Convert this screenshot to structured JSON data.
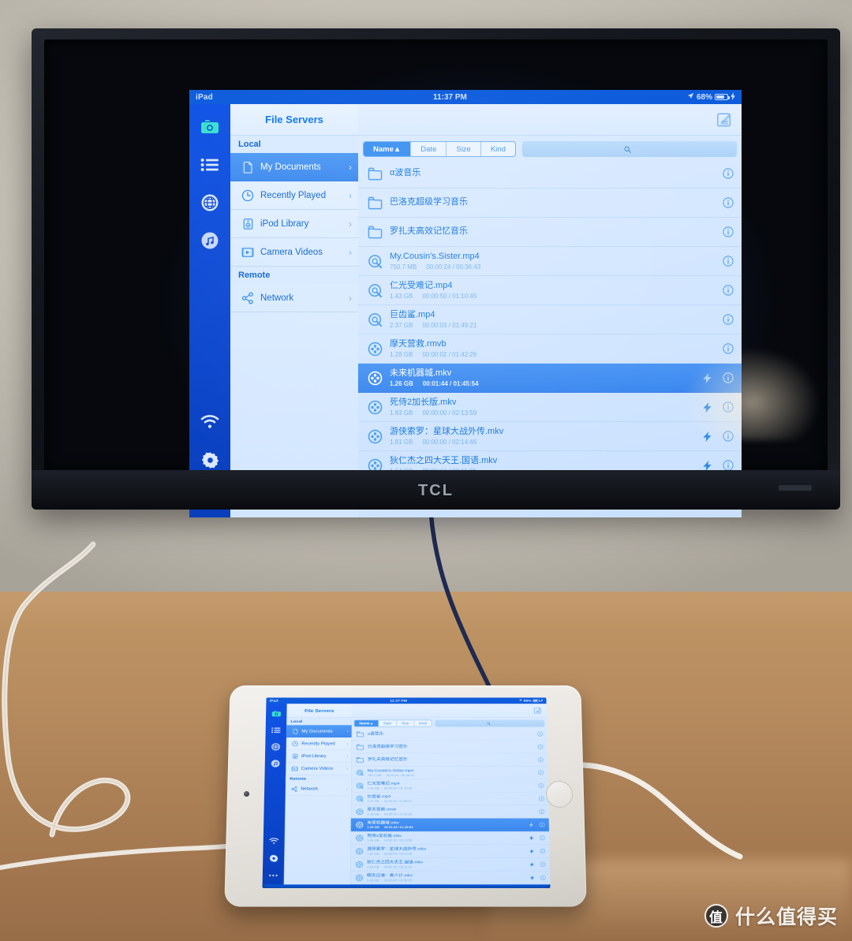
{
  "scene": {
    "tv_brand": "TCL",
    "watermark": {
      "badge": "值",
      "text": "什么值得买"
    }
  },
  "statusbar": {
    "device": "iPad",
    "time": "11:37 PM",
    "battery_percent": "68%",
    "location_icon": "location-arrow-icon",
    "charging_icon": "lightning-bolt-icon"
  },
  "master": {
    "title": "File Servers",
    "groups": [
      {
        "header": "Local",
        "items": [
          {
            "label": "My Documents",
            "icon": "document-icon",
            "selected": true,
            "chevron": "›"
          },
          {
            "label": "Recently Played",
            "icon": "clock-icon",
            "selected": false,
            "chevron": "›"
          },
          {
            "label": "iPod Library",
            "icon": "speaker-icon",
            "selected": false,
            "chevron": "›"
          },
          {
            "label": "Camera Videos",
            "icon": "film-strip-icon",
            "selected": false,
            "chevron": "›"
          }
        ]
      },
      {
        "header": "Remote",
        "items": [
          {
            "label": "Network",
            "icon": "share-nodes-icon",
            "selected": false,
            "chevron": "›"
          }
        ]
      }
    ]
  },
  "rail": {
    "items": [
      {
        "name": "folder-icon",
        "active": true
      },
      {
        "name": "list-icon",
        "active": false
      },
      {
        "name": "globe-icon",
        "active": false
      },
      {
        "name": "music-icon",
        "active": false
      }
    ],
    "bottom_items": [
      {
        "name": "wifi-icon",
        "active": false
      },
      {
        "name": "gear-icon",
        "active": false
      },
      {
        "name": "more-dots-icon",
        "active": false
      }
    ]
  },
  "detail": {
    "compose_icon": "compose-edit-icon",
    "sort_segments": [
      {
        "label": "Name▲",
        "active": true
      },
      {
        "label": "Date",
        "active": false
      },
      {
        "label": "Size",
        "active": false
      },
      {
        "label": "Kind",
        "active": false
      }
    ],
    "search": {
      "placeholder": "",
      "value": "",
      "icon": "search-icon"
    }
  },
  "files": [
    {
      "name": "α波音乐",
      "type": "folder",
      "icon": "folder-outline-icon",
      "size": "",
      "time": "",
      "bolt": false,
      "selected": false
    },
    {
      "name": "巴洛克超级学习音乐",
      "type": "folder",
      "icon": "folder-outline-icon",
      "size": "",
      "time": "",
      "bolt": false,
      "selected": false
    },
    {
      "name": "罗扎夫高效记忆音乐",
      "type": "folder",
      "icon": "folder-outline-icon",
      "size": "",
      "time": "",
      "bolt": false,
      "selected": false
    },
    {
      "name": "My.Cousin's.Sister.mp4",
      "type": "video",
      "icon": "quicktime-icon",
      "size": "750.7 MB",
      "time": "00:00:24 / 00:36:43",
      "bolt": false,
      "selected": false
    },
    {
      "name": "仁光受难记.mp4",
      "type": "video",
      "icon": "quicktime-icon",
      "size": "1.43 GB",
      "time": "00:00:50 / 01:10:45",
      "bolt": false,
      "selected": false
    },
    {
      "name": "巨齿鲨.mp4",
      "type": "video",
      "icon": "quicktime-icon",
      "size": "2.37 GB",
      "time": "00:00:03 / 01:49:21",
      "bolt": false,
      "selected": false
    },
    {
      "name": "摩天营救.rmvb",
      "type": "video",
      "icon": "film-reel-icon",
      "size": "1.28 GB",
      "time": "00:00:02 / 01:42:26",
      "bolt": false,
      "selected": false
    },
    {
      "name": "未来机器城.mkv",
      "type": "video",
      "icon": "film-reel-icon",
      "size": "1.26 GB",
      "time": "00:01:44 / 01:45:54",
      "bolt": true,
      "selected": true
    },
    {
      "name": "死侍2加长版.mkv",
      "type": "video",
      "icon": "film-reel-icon",
      "size": "1.83 GB",
      "time": "00:00:00 / 02:13:59",
      "bolt": true,
      "selected": false
    },
    {
      "name": "游侠索罗：星球大战外传.mkv",
      "type": "video",
      "icon": "film-reel-icon",
      "size": "1.81 GB",
      "time": "00:00:00 / 02:14:46",
      "bolt": true,
      "selected": false
    },
    {
      "name": "狄仁杰之四大天王.国语.mkv",
      "type": "video",
      "icon": "film-reel-icon",
      "size": "1.64 GB",
      "time": "00:00:16 / 02:11:39",
      "bolt": true,
      "selected": false
    },
    {
      "name": "瞒天过海：美人计.mkv",
      "type": "video",
      "icon": "film-reel-icon",
      "size": "1.49 GB",
      "time": "00:00:00 / 01:50:07",
      "bolt": true,
      "selected": false
    }
  ],
  "colors": {
    "accent": "#3f93f2",
    "rail_bg": "#0b47cf",
    "selected_row": "#4a95f4",
    "text_blue": "#1b7ad8",
    "meta_blue": "#7ab4e6",
    "rail_active": "#3ae0cf"
  }
}
